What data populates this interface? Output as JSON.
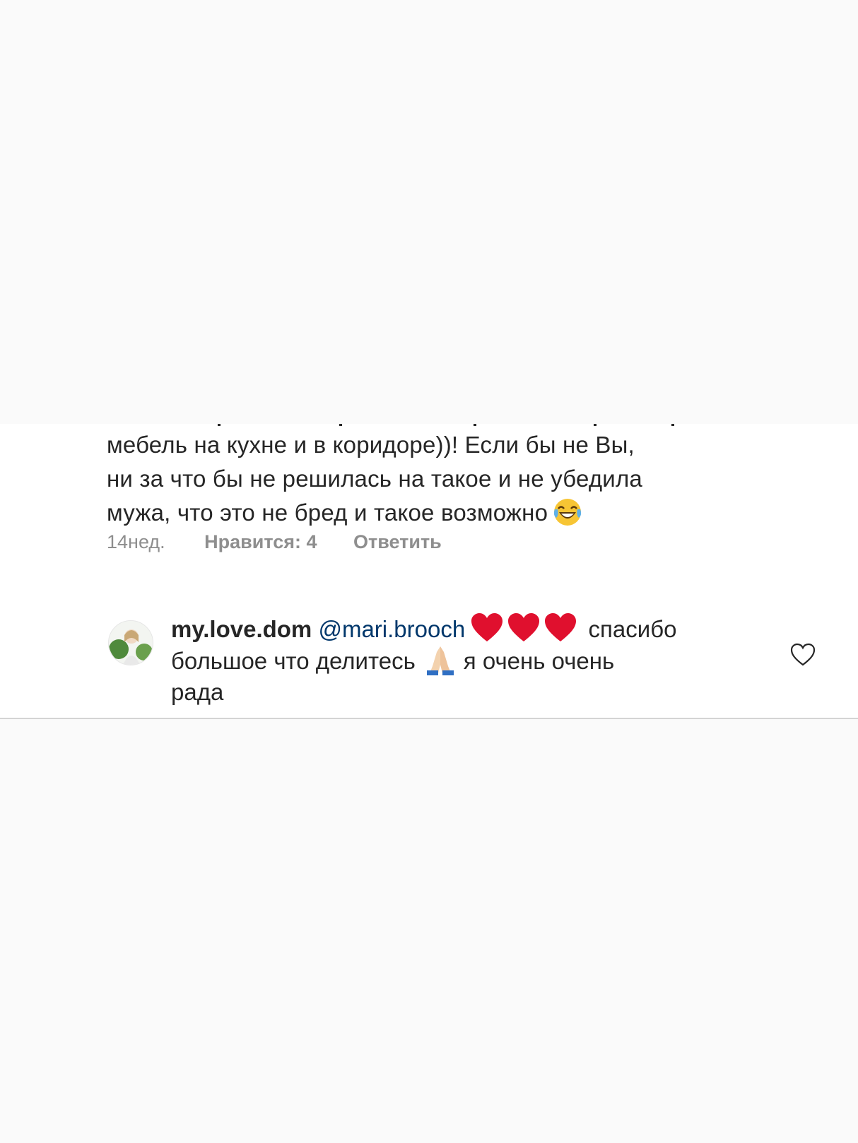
{
  "comment": {
    "truncated_line": "",
    "lines": [
      "мебель на кухне и в коридоре))! Если бы не Вы,",
      "ни за что бы не решилась на такое и не убедила",
      "мужа, что это не бред и такое возможно"
    ],
    "emoji": "face-with-tears-of-joy",
    "meta": {
      "time": "14нед.",
      "likes": "Нравится: 4",
      "reply": "Ответить"
    }
  },
  "reply": {
    "username": "my.love.dom",
    "mention": "@mari.brooch",
    "text_after_hearts": "спасибо",
    "line2": "большое что делитесь",
    "line2_after": "я очень очень",
    "line3": "рада",
    "emojis": [
      "red-heart",
      "red-heart",
      "red-heart",
      "folded-hands"
    ],
    "like_icon": "heart-outline-icon"
  },
  "colors": {
    "text": "#262626",
    "meta": "#8e8e8e",
    "mention": "#00376b",
    "background_outer": "#fafafa",
    "background_panel": "#ffffff",
    "heart_red": "#e0102e"
  }
}
